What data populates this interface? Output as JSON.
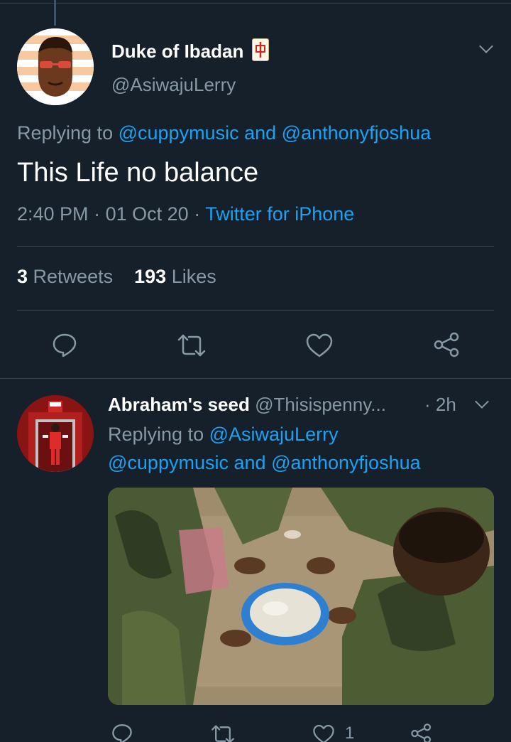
{
  "main_tweet": {
    "display_name": "Duke of Ibadan",
    "handle": "@AsiwajuLerry",
    "replying_prefix": "Replying to",
    "replying_to_1": "@cuppymusic",
    "replying_and": "and",
    "replying_to_2": "@anthonyfjoshua",
    "text": "This Life no balance",
    "time": "2:40 PM",
    "date": "01 Oct 20",
    "separator": "·",
    "source": "Twitter for iPhone",
    "retweets_count": "3",
    "retweets_label": "Retweets",
    "likes_count": "193",
    "likes_label": "Likes"
  },
  "reply_tweet": {
    "display_name": "Abraham's seed",
    "handle": "@Thisispenny...",
    "time": "· 2h",
    "replying_prefix": "Replying to",
    "replying_to_1": "@AsiwajuLerry",
    "replying_to_2": "@cuppymusic",
    "replying_and": "and",
    "replying_to_3": "@anthonyfjoshua",
    "likes_count": "1"
  },
  "colors": {
    "background": "#15202b",
    "accent": "#1da1f2",
    "muted": "#8899a6",
    "divider": "#38444d"
  },
  "icons": [
    "chevron-down-icon",
    "reply-icon",
    "retweet-icon",
    "like-icon",
    "share-icon",
    "mahjong-tile-icon"
  ]
}
